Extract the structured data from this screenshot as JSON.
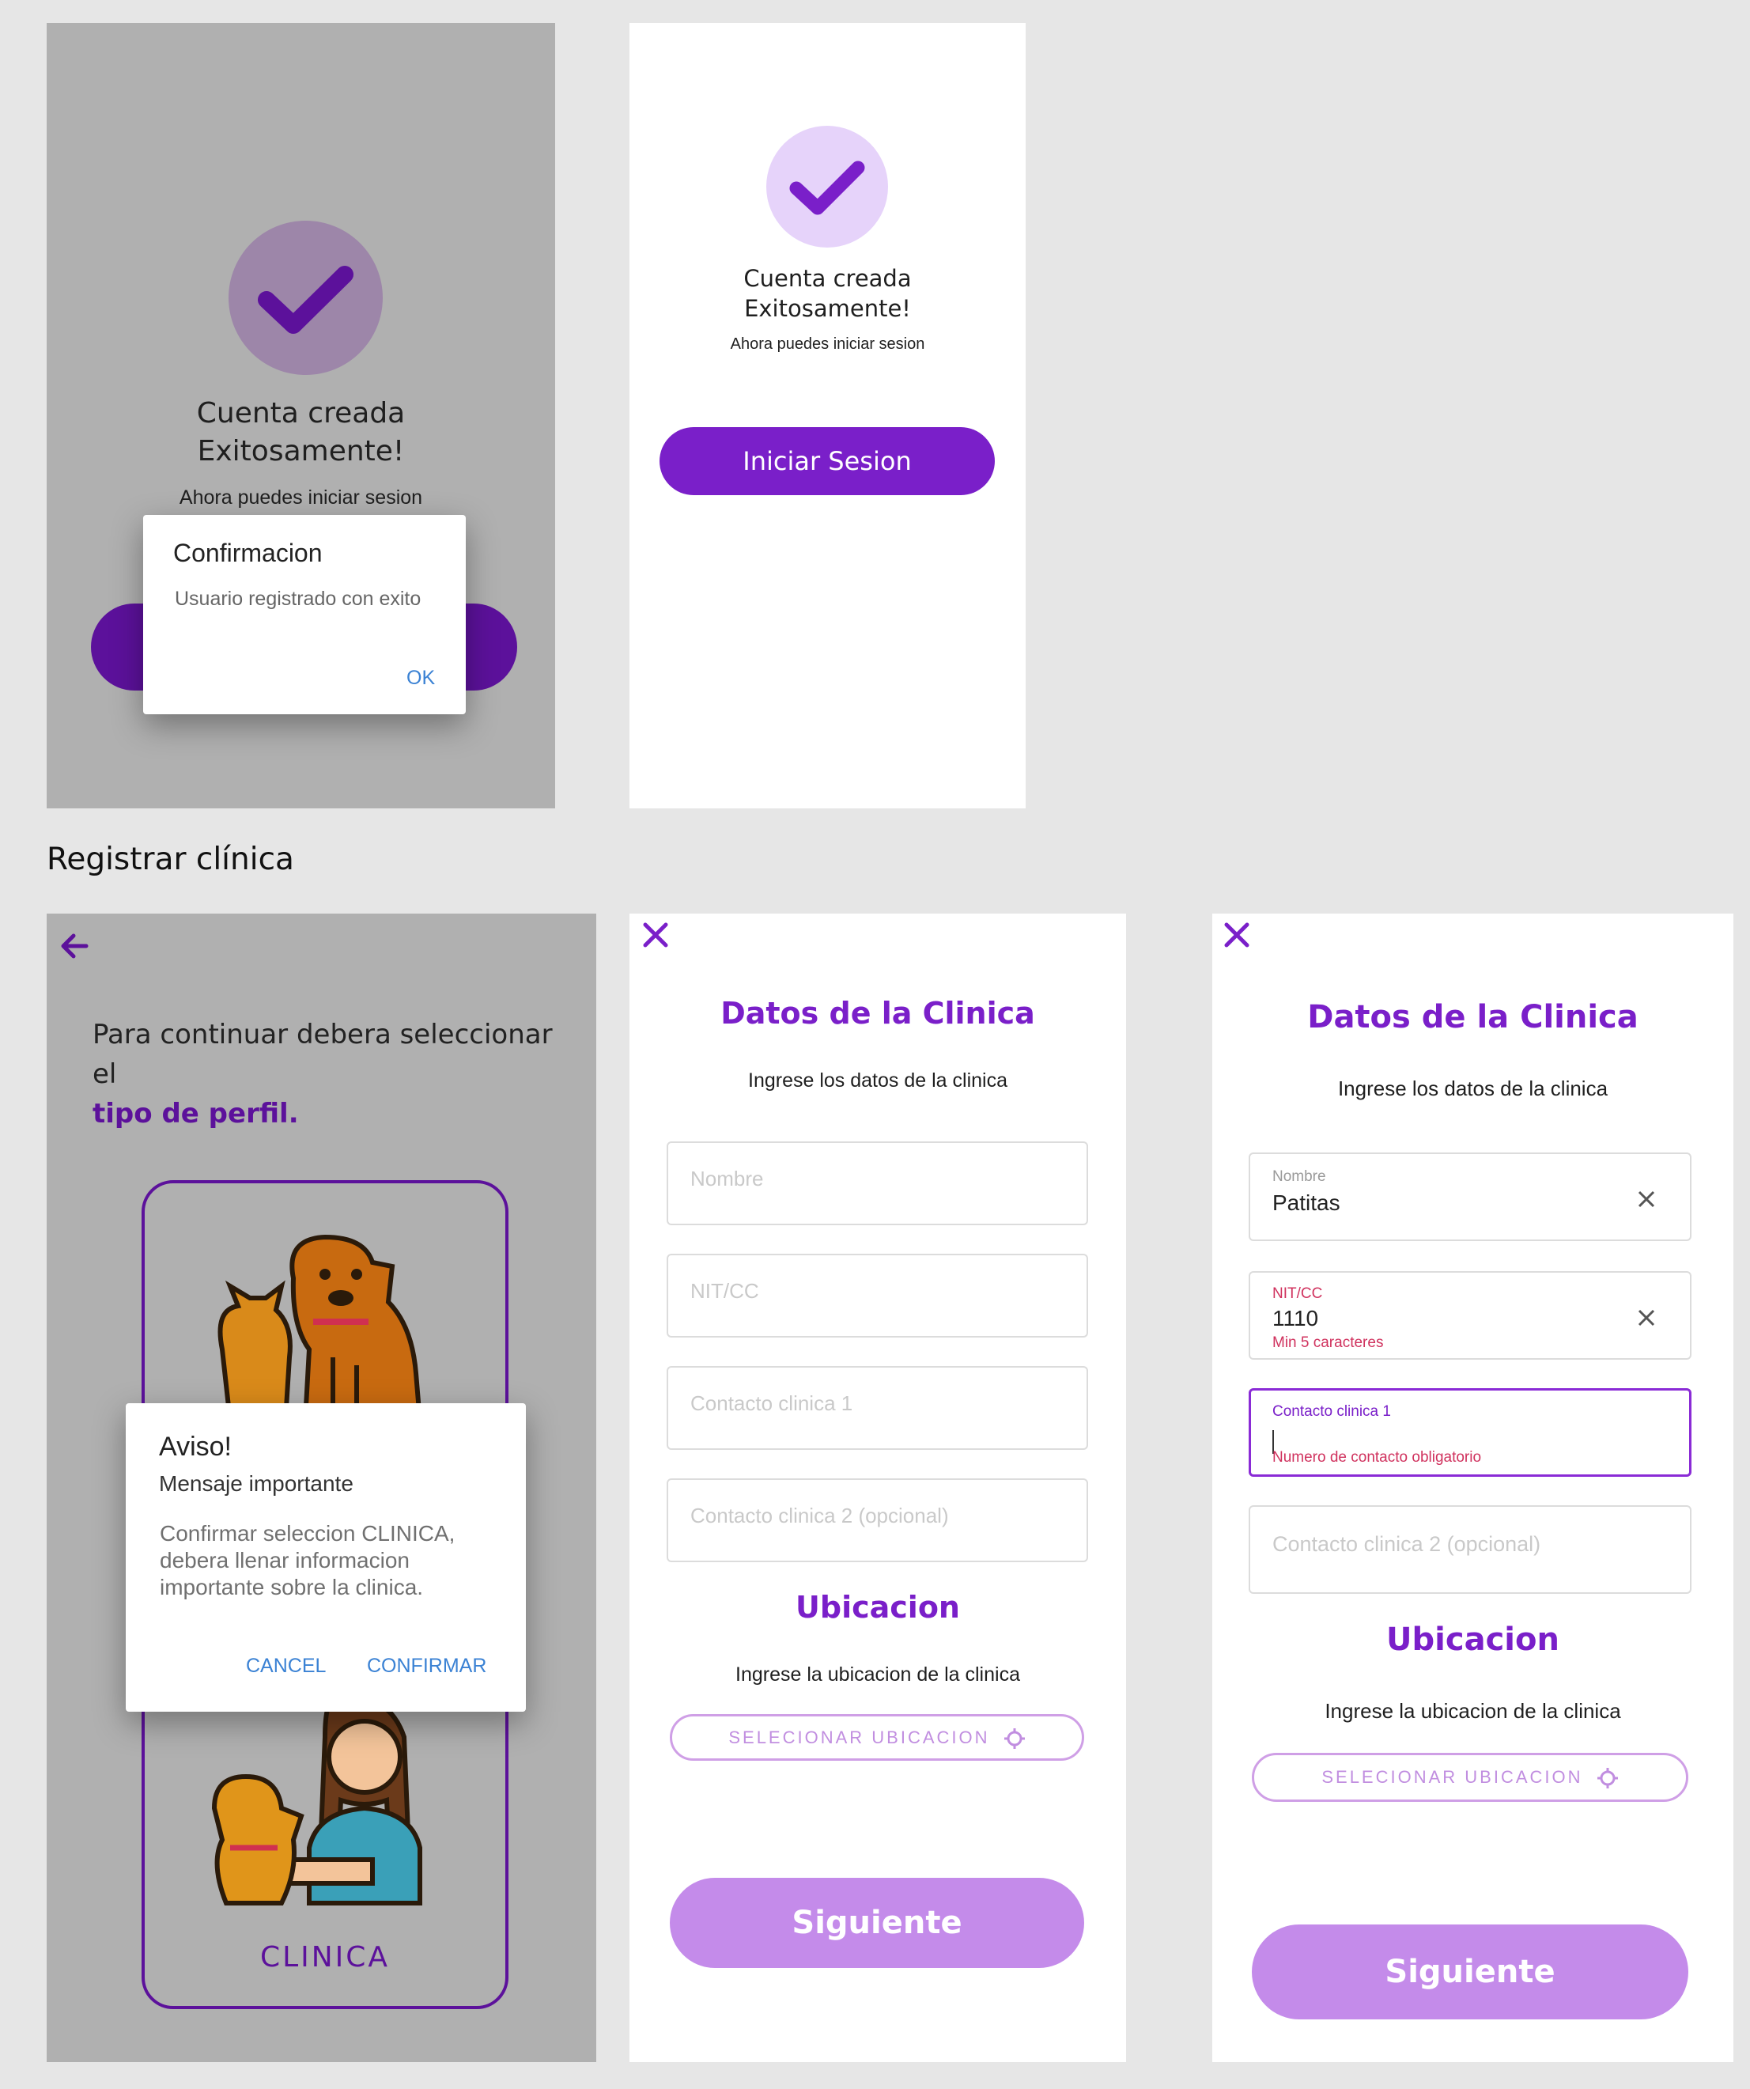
{
  "screen1": {
    "success_title_line1": "Cuenta creada",
    "success_title_line2": "Exitosamente!",
    "success_subtitle": "Ahora puedes iniciar sesion",
    "dialog": {
      "title": "Confirmacion",
      "message": "Usuario registrado con exito",
      "ok_label": "OK"
    }
  },
  "screen2": {
    "success_title_line1": "Cuenta creada",
    "success_title_line2": "Exitosamente!",
    "success_subtitle": "Ahora puedes iniciar sesion",
    "login_button": "Iniciar Sesion"
  },
  "section_title": "Registrar clínica",
  "screen3": {
    "prompt_text": "Para continuar debera seleccionar el",
    "prompt_bold": "tipo de perfil.",
    "card_label": "CLINICA",
    "dialog": {
      "title": "Aviso!",
      "subtitle": "Mensaje importante",
      "body_line1": "Confirmar seleccion CLINICA,",
      "body_line2": "debera llenar informacion",
      "body_line3": "importante sobre la clinica.",
      "cancel_label": "CANCEL",
      "confirm_label": "CONFIRMAR"
    }
  },
  "screen4": {
    "title": "Datos de la Clinica",
    "subtitle": "Ingrese los datos de la clinica",
    "fields": {
      "nombre_placeholder": "Nombre",
      "nit_placeholder": "NIT/CC",
      "contacto1_placeholder": "Contacto clinica 1",
      "contacto2_placeholder": "Contacto clinica 2 (opcional)"
    },
    "location_title": "Ubicacion",
    "location_subtitle": "Ingrese la ubicacion de la clinica",
    "location_button": "SELECIONAR UBICACION",
    "next_button": "Siguiente"
  },
  "screen5": {
    "title": "Datos de la Clinica",
    "subtitle": "Ingrese los datos de la clinica",
    "fields": {
      "nombre_label": "Nombre",
      "nombre_value": "Patitas",
      "nit_label": "NIT/CC",
      "nit_value": "1110",
      "nit_error": "Min 5 caracteres",
      "contacto1_label": "Contacto clinica 1",
      "contacto1_error": "Numero de contacto obligatorio",
      "contacto2_placeholder": "Contacto clinica 2 (opcional)"
    },
    "location_title": "Ubicacion",
    "location_subtitle": "Ingrese la ubicacion de la clinica",
    "location_button": "SELECIONAR UBICACION",
    "next_button": "Siguiente"
  },
  "colors": {
    "accent": "#7a1fc9",
    "light_accent": "#c48bea",
    "check_bg": "#e6d3fa",
    "error": "#d0325e",
    "overlay_gray": "#b0b0b0",
    "page_bg": "#e6e6e6"
  },
  "icons": [
    "check-icon",
    "back-arrow-icon",
    "close-icon",
    "clear-icon",
    "crosshair-icon",
    "pets-illustration",
    "vet-illustration"
  ]
}
